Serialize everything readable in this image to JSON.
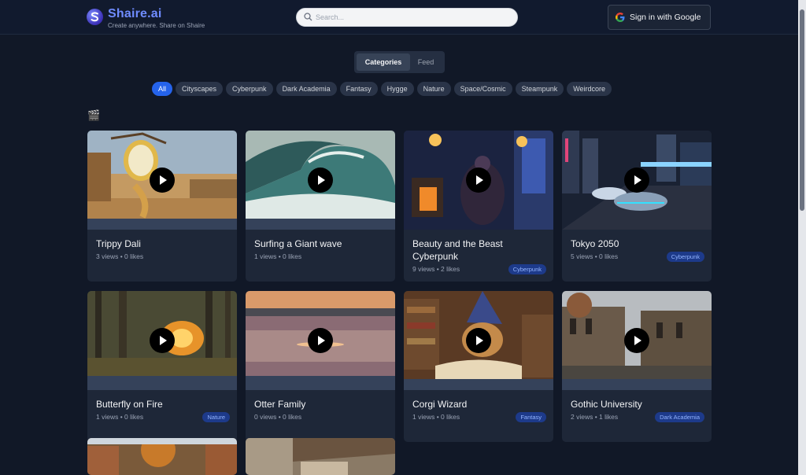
{
  "header": {
    "brand": "Shaire.ai",
    "tagline": "Create anywhere. Share on Shaire",
    "search_placeholder": "Search...",
    "signin_label": "Sign in with Google"
  },
  "view_toggle": {
    "active": "Categories",
    "inactive": "Feed"
  },
  "categories": [
    "All",
    "Cityscapes",
    "Cyberpunk",
    "Dark Academia",
    "Fantasy",
    "Hygge",
    "Nature",
    "Space/Cosmic",
    "Steampunk",
    "Weirdcore"
  ],
  "section_icon": "🎬",
  "videos": [
    {
      "title": "Trippy Dali",
      "meta": "3 views • 0 likes",
      "tag": ""
    },
    {
      "title": "Surfing a Giant wave",
      "meta": "1 views • 0 likes",
      "tag": ""
    },
    {
      "title": "Beauty and the Beast Cyberpunk",
      "meta": "9 views • 2 likes",
      "tag": "Cyberpunk"
    },
    {
      "title": "Tokyo 2050",
      "meta": "5 views • 0 likes",
      "tag": "Cyberpunk"
    },
    {
      "title": "Butterfly on Fire",
      "meta": "1 views • 0 likes",
      "tag": "Nature"
    },
    {
      "title": "Otter Family",
      "meta": "0 views • 0 likes",
      "tag": ""
    },
    {
      "title": "Corgi Wizard",
      "meta": "1 views • 0 likes",
      "tag": "Fantasy"
    },
    {
      "title": "Gothic University",
      "meta": "2 views • 1 likes",
      "tag": "Dark Academia"
    }
  ],
  "colors": {
    "accent": "#2563eb",
    "brand": "#6f8cff",
    "background": "#111827",
    "card": "#1e2738"
  }
}
